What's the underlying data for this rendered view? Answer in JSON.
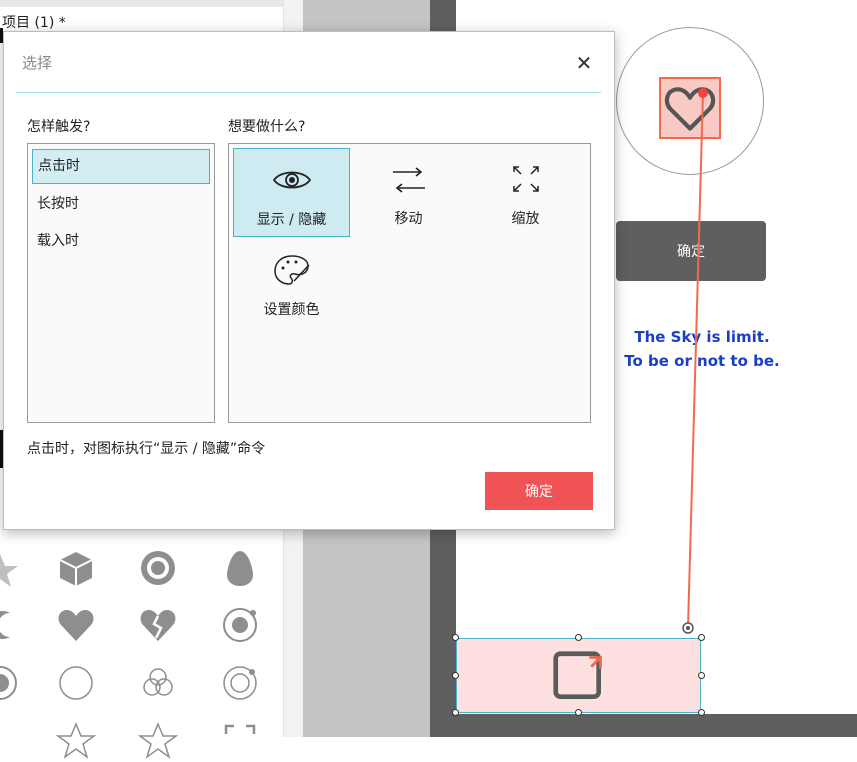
{
  "app": {
    "project_title": "项目 (1) *"
  },
  "canvas": {
    "confirm_button_label": "确定",
    "text_line1": "The Sky is limit.",
    "text_line2": "To be or not to be."
  },
  "dialog": {
    "title": "选择",
    "close_icon": "close-icon",
    "trigger_heading": "怎样触发?",
    "action_heading": "想要做什么?",
    "triggers": [
      {
        "label": "点击时",
        "selected": true
      },
      {
        "label": "长按时",
        "selected": false
      },
      {
        "label": "载入时",
        "selected": false
      }
    ],
    "actions": [
      {
        "label": "显示 / 隐藏",
        "icon": "eye-icon",
        "selected": true
      },
      {
        "label": "移动",
        "icon": "move-arrows-icon",
        "selected": false
      },
      {
        "label": "缩放",
        "icon": "zoom-arrows-icon",
        "selected": false
      },
      {
        "label": "设置颜色",
        "icon": "palette-icon",
        "selected": false
      }
    ],
    "status": "点击时，对图标执行“显示 / 隐藏”命令",
    "ok_label": "确定"
  },
  "colors": {
    "accent_teal": "#4ab3c7",
    "ok_red": "#f05356",
    "canvas_text_blue": "#1a3ec9",
    "link_orange": "#f06a4f"
  }
}
